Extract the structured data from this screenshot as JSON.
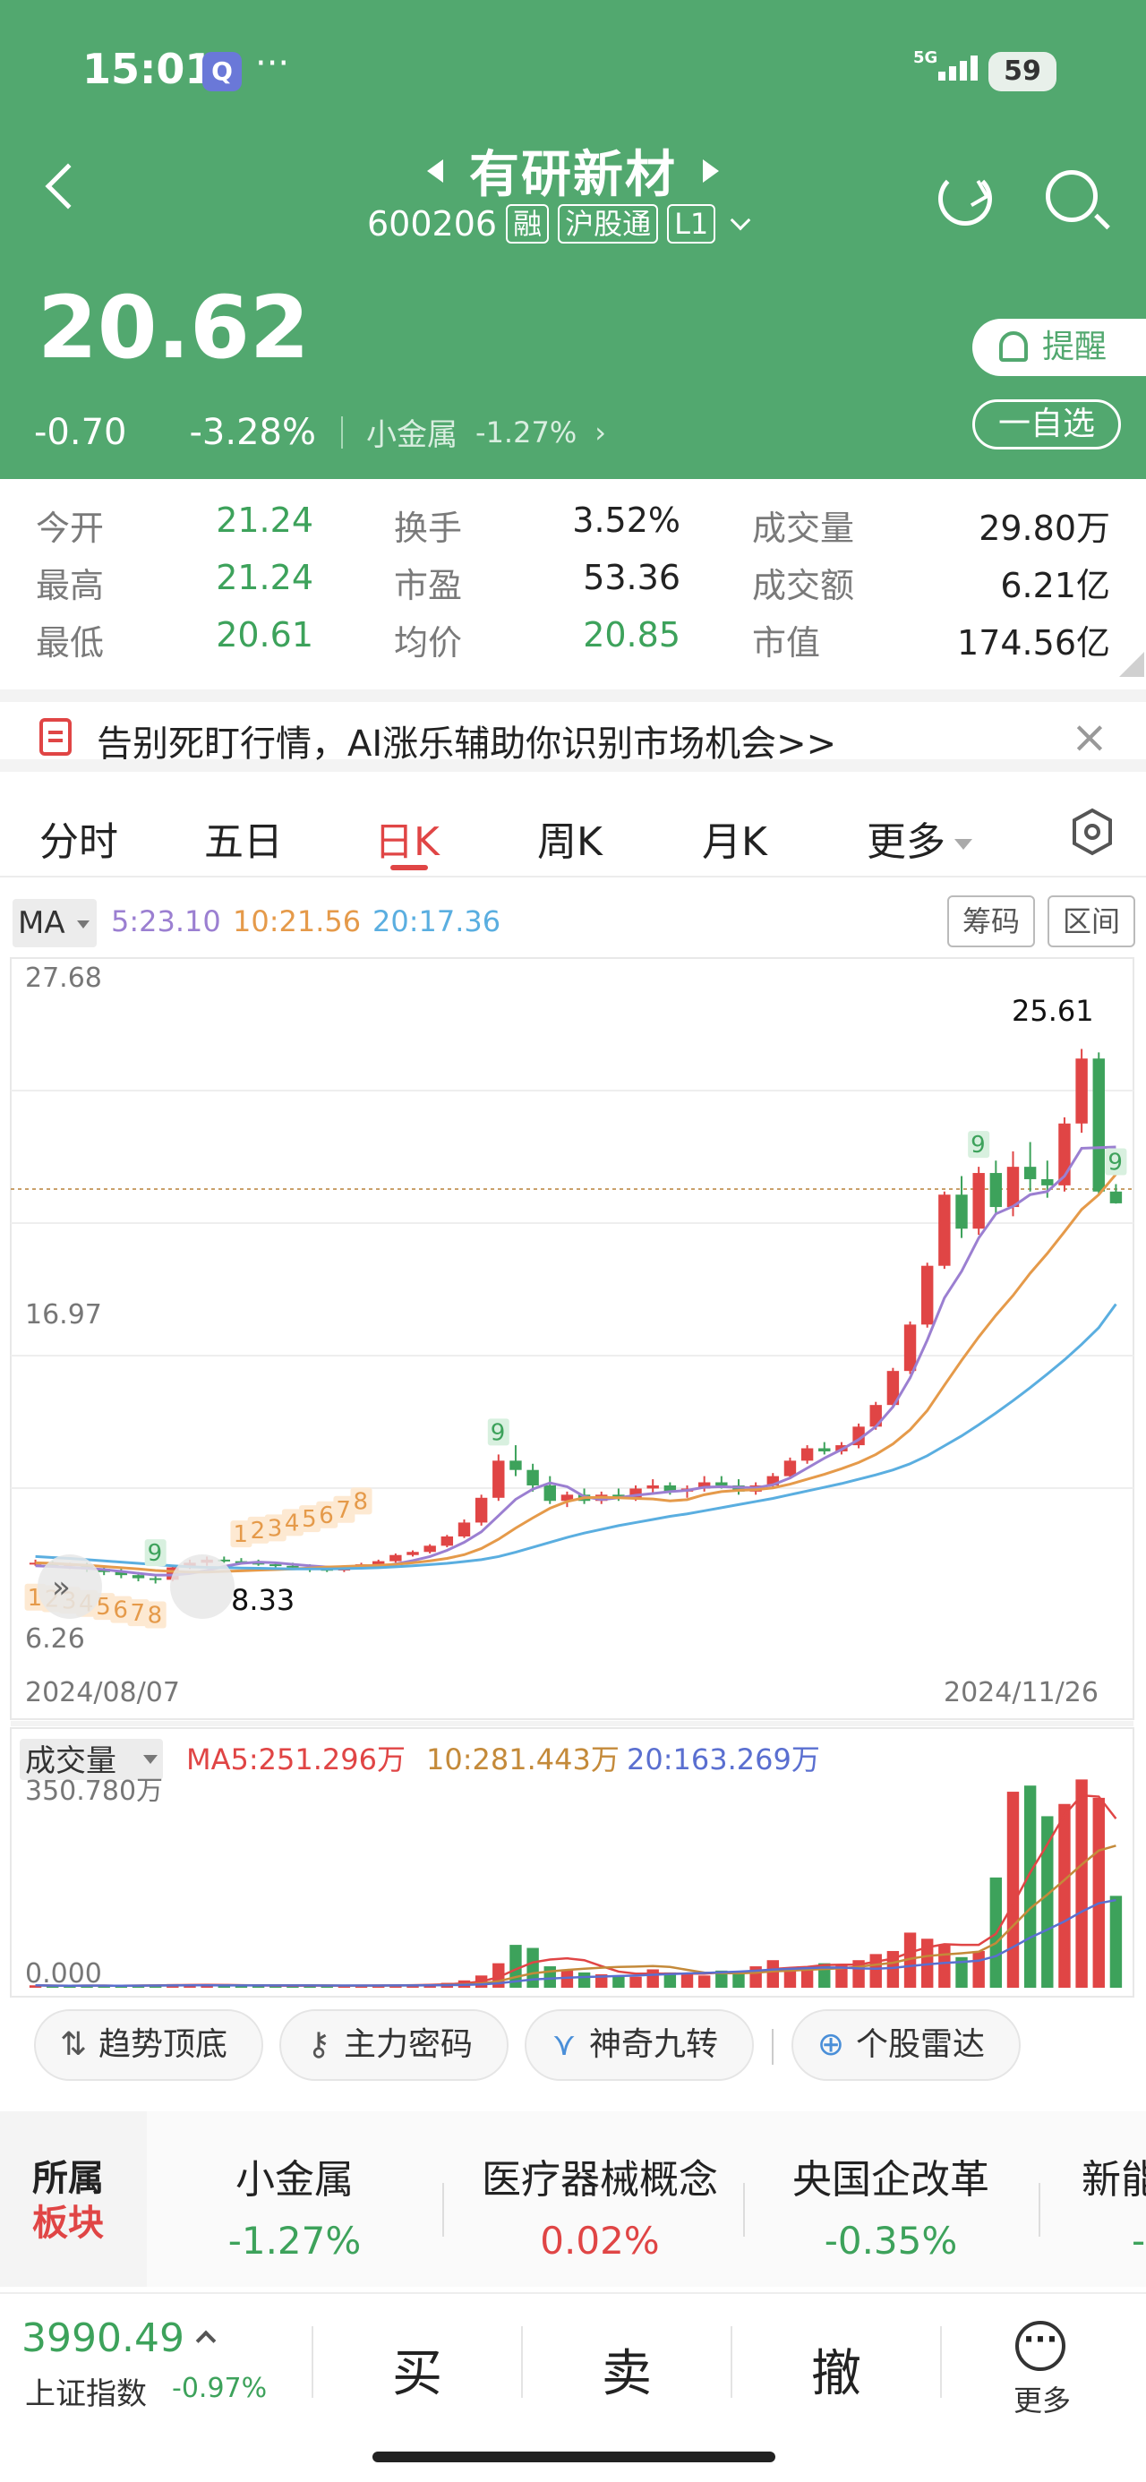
{
  "status_bar": {
    "time": "15:01",
    "q_icon": "Q",
    "dots": "···",
    "network": "5G",
    "battery": "59"
  },
  "header": {
    "name": "有研新材",
    "code": "600206",
    "tags": [
      "融",
      "沪股通",
      "L1"
    ]
  },
  "quote": {
    "price": "20.62",
    "change": "-0.70",
    "change_pct": "-3.28%",
    "sector": "小金属",
    "sector_pct": "-1.27%",
    "sector_arrow": "›",
    "remind_label": "提醒",
    "watch_label": "一自选"
  },
  "stats": [
    {
      "label": "今开",
      "value": "21.24"
    },
    {
      "label": "换手",
      "value": "3.52%"
    },
    {
      "label": "成交量",
      "value": "29.80万"
    },
    {
      "label": "最高",
      "value": "21.24"
    },
    {
      "label": "市盈",
      "value": "53.36"
    },
    {
      "label": "成交额",
      "value": "6.21亿"
    },
    {
      "label": "最低",
      "value": "20.61"
    },
    {
      "label": "均价",
      "value": "20.85"
    },
    {
      "label": "市值",
      "value": "174.56亿"
    }
  ],
  "banner": {
    "text": "告别死盯行情，AI涨乐辅助你识别市场机会>>",
    "close": "×"
  },
  "tabs": [
    "分时",
    "五日",
    "日K",
    "周K",
    "月K",
    "更多"
  ],
  "ma_row": {
    "selector": "MA",
    "ma5": "5:23.10",
    "ma10": "10:21.56",
    "ma20": "20:17.36",
    "btn_chips": "筹码",
    "btn_range": "区间"
  },
  "chart_data": {
    "type": "candlestick",
    "y_ticks": [
      "27.68",
      "16.97",
      "6.26"
    ],
    "x_labels": [
      "2024/08/07",
      "2024/11/26"
    ],
    "ylim": [
      6.26,
      27.68
    ],
    "annotations": {
      "high": "25.61",
      "low": "8.33"
    },
    "ohlc": [
      [
        9.0,
        9.1,
        8.9,
        9.0
      ],
      [
        9.0,
        9.05,
        8.85,
        8.9
      ],
      [
        8.9,
        9.0,
        8.8,
        8.95
      ],
      [
        8.95,
        9.0,
        8.7,
        8.8
      ],
      [
        8.8,
        8.9,
        8.6,
        8.7
      ],
      [
        8.7,
        8.8,
        8.5,
        8.6
      ],
      [
        8.6,
        8.7,
        8.4,
        8.5
      ],
      [
        8.5,
        8.6,
        8.33,
        8.45
      ],
      [
        8.45,
        8.9,
        8.4,
        8.85
      ],
      [
        8.85,
        9.1,
        8.8,
        9.0
      ],
      [
        9.0,
        9.2,
        8.9,
        9.1
      ],
      [
        9.1,
        9.2,
        9.0,
        9.05
      ],
      [
        9.05,
        9.15,
        8.95,
        9.0
      ],
      [
        9.0,
        9.1,
        8.9,
        8.95
      ],
      [
        8.95,
        9.0,
        8.8,
        8.9
      ],
      [
        8.9,
        9.0,
        8.8,
        8.85
      ],
      [
        8.85,
        8.95,
        8.7,
        8.8
      ],
      [
        8.8,
        8.9,
        8.7,
        8.75
      ],
      [
        8.75,
        8.9,
        8.7,
        8.85
      ],
      [
        8.85,
        9.0,
        8.8,
        8.95
      ],
      [
        8.95,
        9.1,
        8.9,
        9.05
      ],
      [
        9.05,
        9.3,
        9.0,
        9.25
      ],
      [
        9.25,
        9.4,
        9.2,
        9.35
      ],
      [
        9.35,
        9.6,
        9.3,
        9.55
      ],
      [
        9.55,
        9.9,
        9.5,
        9.85
      ],
      [
        9.85,
        10.4,
        9.8,
        10.3
      ],
      [
        10.3,
        11.2,
        10.2,
        11.1
      ],
      [
        11.1,
        12.5,
        11.0,
        12.3
      ],
      [
        12.3,
        12.8,
        11.8,
        12.0
      ],
      [
        12.0,
        12.2,
        11.3,
        11.5
      ],
      [
        11.5,
        11.8,
        10.9,
        11.0
      ],
      [
        11.0,
        11.3,
        10.8,
        11.2
      ],
      [
        11.2,
        11.4,
        10.9,
        11.0
      ],
      [
        11.0,
        11.3,
        10.9,
        11.2
      ],
      [
        11.2,
        11.4,
        11.0,
        11.1
      ],
      [
        11.1,
        11.5,
        11.0,
        11.4
      ],
      [
        11.4,
        11.7,
        11.2,
        11.5
      ],
      [
        11.5,
        11.6,
        11.2,
        11.3
      ],
      [
        11.3,
        11.5,
        11.1,
        11.4
      ],
      [
        11.4,
        11.8,
        11.3,
        11.6
      ],
      [
        11.6,
        11.8,
        11.4,
        11.5
      ],
      [
        11.5,
        11.7,
        11.2,
        11.3
      ],
      [
        11.3,
        11.6,
        11.2,
        11.5
      ],
      [
        11.5,
        11.9,
        11.4,
        11.8
      ],
      [
        11.8,
        12.4,
        11.7,
        12.3
      ],
      [
        12.3,
        12.8,
        12.2,
        12.7
      ],
      [
        12.7,
        12.9,
        12.5,
        12.6
      ],
      [
        12.6,
        12.9,
        12.5,
        12.8
      ],
      [
        12.8,
        13.5,
        12.7,
        13.4
      ],
      [
        13.4,
        14.2,
        13.3,
        14.1
      ],
      [
        14.1,
        15.3,
        14.0,
        15.2
      ],
      [
        15.2,
        16.8,
        15.1,
        16.7
      ],
      [
        16.7,
        18.7,
        16.6,
        18.6
      ],
      [
        18.6,
        21.0,
        18.5,
        20.9
      ],
      [
        20.9,
        21.5,
        19.5,
        19.8
      ],
      [
        19.8,
        21.8,
        19.6,
        21.6
      ],
      [
        21.6,
        22.0,
        20.3,
        20.5
      ],
      [
        20.5,
        22.3,
        20.2,
        21.8
      ],
      [
        21.8,
        22.6,
        21.0,
        21.4
      ],
      [
        21.4,
        22.0,
        20.8,
        21.2
      ],
      [
        21.2,
        23.4,
        21.0,
        23.2
      ],
      [
        23.2,
        25.61,
        22.9,
        25.3
      ],
      [
        25.3,
        25.5,
        20.9,
        21.0
      ],
      [
        21.0,
        21.24,
        20.61,
        20.62
      ]
    ],
    "ma5_series": [
      8.9,
      8.88,
      8.85,
      8.82,
      8.78,
      8.72,
      8.66,
      8.6,
      8.6,
      8.65,
      8.75,
      8.88,
      8.98,
      9.02,
      9.0,
      8.95,
      8.9,
      8.86,
      8.83,
      8.84,
      8.88,
      8.96,
      9.07,
      9.2,
      9.4,
      9.66,
      10.0,
      10.52,
      11.05,
      11.38,
      11.58,
      11.46,
      11.14,
      11.04,
      11.1,
      11.18,
      11.24,
      11.3,
      11.34,
      11.44,
      11.46,
      11.44,
      11.42,
      11.52,
      11.74,
      12.06,
      12.38,
      12.66,
      12.98,
      13.4,
      14.04,
      14.98,
      16.2,
      17.56,
      18.42,
      19.5,
      20.28,
      20.52,
      20.9,
      21.0,
      21.5,
      22.4,
      22.42,
      22.44
    ],
    "ma10_series": [
      9.0,
      8.98,
      8.95,
      8.92,
      8.88,
      8.84,
      8.8,
      8.75,
      8.72,
      8.7,
      8.7,
      8.72,
      8.74,
      8.76,
      8.78,
      8.8,
      8.83,
      8.86,
      8.88,
      8.9,
      8.92,
      8.95,
      9.0,
      9.06,
      9.14,
      9.26,
      9.46,
      9.76,
      10.12,
      10.45,
      10.76,
      10.98,
      11.1,
      11.12,
      11.1,
      11.08,
      11.06,
      11.0,
      11.04,
      11.2,
      11.3,
      11.34,
      11.36,
      11.42,
      11.54,
      11.7,
      11.86,
      12.04,
      12.24,
      12.5,
      12.84,
      13.3,
      13.92,
      14.74,
      15.54,
      16.3,
      17.0,
      17.64,
      18.36,
      19.0,
      19.7,
      20.42,
      20.9,
      21.56
    ],
    "ma20_series": [
      9.2,
      9.17,
      9.14,
      9.1,
      9.06,
      9.02,
      8.98,
      8.94,
      8.9,
      8.87,
      8.85,
      8.84,
      8.83,
      8.82,
      8.81,
      8.8,
      8.8,
      8.8,
      8.81,
      8.82,
      8.84,
      8.87,
      8.9,
      8.94,
      8.98,
      9.04,
      9.1,
      9.2,
      9.34,
      9.5,
      9.66,
      9.82,
      9.96,
      10.08,
      10.2,
      10.3,
      10.4,
      10.5,
      10.58,
      10.68,
      10.78,
      10.88,
      10.98,
      11.08,
      11.2,
      11.32,
      11.44,
      11.56,
      11.7,
      11.84,
      12.0,
      12.2,
      12.46,
      12.78,
      13.1,
      13.46,
      13.84,
      14.24,
      14.66,
      15.1,
      15.56,
      16.06,
      16.6,
      17.36
    ],
    "signals": {
      "seq_red": [
        [
          12,
          "1"
        ],
        [
          13,
          "2"
        ],
        [
          14,
          "3"
        ],
        [
          15,
          "4"
        ],
        [
          16,
          "5"
        ],
        [
          17,
          "6"
        ],
        [
          18,
          "7"
        ],
        [
          19,
          "8"
        ]
      ],
      "seq_red_low": [
        [
          0,
          "1"
        ],
        [
          1,
          "2"
        ],
        [
          2,
          "3"
        ],
        [
          3,
          "4"
        ],
        [
          4,
          "5"
        ],
        [
          5,
          "6"
        ],
        [
          6,
          "7"
        ],
        [
          7,
          "8"
        ]
      ],
      "green9": [
        [
          7,
          "9"
        ],
        [
          27,
          "9"
        ],
        [
          55,
          "9"
        ],
        [
          63,
          "9"
        ]
      ]
    },
    "volume": {
      "label": "成交量",
      "ma5_label": "MA5:251.296万",
      "ma10_label": "10:281.443万",
      "ma20_label": "20:163.269万",
      "top": "350.780万",
      "bottom": "0.000",
      "ylim": [
        0,
        350.78
      ],
      "values": [
        4,
        3,
        3,
        4,
        3,
        3,
        4,
        5,
        6,
        5,
        4,
        3,
        3,
        4,
        3,
        3,
        4,
        3,
        3,
        4,
        4,
        5,
        5,
        6,
        8,
        12,
        20,
        40,
        70,
        65,
        35,
        30,
        25,
        22,
        20,
        18,
        30,
        25,
        22,
        20,
        28,
        25,
        35,
        45,
        30,
        35,
        40,
        38,
        45,
        55,
        60,
        90,
        80,
        70,
        50,
        60,
        180,
        320,
        330,
        280,
        300,
        340,
        310,
        150
      ],
      "colors": [
        "r",
        "g",
        "g",
        "g",
        "g",
        "g",
        "g",
        "g",
        "r",
        "r",
        "r",
        "g",
        "g",
        "g",
        "g",
        "g",
        "g",
        "g",
        "r",
        "r",
        "r",
        "r",
        "r",
        "r",
        "r",
        "r",
        "r",
        "r",
        "g",
        "g",
        "g",
        "r",
        "g",
        "r",
        "g",
        "r",
        "r",
        "g",
        "r",
        "r",
        "g",
        "g",
        "r",
        "r",
        "r",
        "r",
        "g",
        "r",
        "r",
        "r",
        "r",
        "r",
        "r",
        "r",
        "g",
        "r",
        "g",
        "r",
        "g",
        "g",
        "r",
        "r",
        "r",
        "g"
      ]
    }
  },
  "shortcuts": [
    {
      "icon": "⇅",
      "label": "趋势顶底"
    },
    {
      "icon": "⚷",
      "label": "主力密码"
    },
    {
      "icon": "⋎",
      "label": "神奇九转"
    },
    {
      "icon": "⊕",
      "label": "个股雷达"
    }
  ],
  "sectors": {
    "head1": "所属",
    "head2": "板块",
    "items": [
      {
        "name": "小金属",
        "pct": "-1.27%"
      },
      {
        "name": "医疗器械概念",
        "pct": "0.02%"
      },
      {
        "name": "央国企改革",
        "pct": "-0.35%"
      },
      {
        "name": "新能",
        "pct": "-"
      }
    ]
  },
  "bottom": {
    "index_value": "3990.49",
    "index_name": "上证指数",
    "index_pct": "-0.97%",
    "buy": "买",
    "sell": "卖",
    "cancel": "撤",
    "more": "更多",
    "more_icon": "···"
  },
  "colors": {
    "brand_green": "#52a86f",
    "up_red": "#e04545",
    "down_green": "#3da25b",
    "ma5": "#9b7fd1",
    "ma10": "#e59a4a",
    "ma20": "#5aaee0"
  }
}
